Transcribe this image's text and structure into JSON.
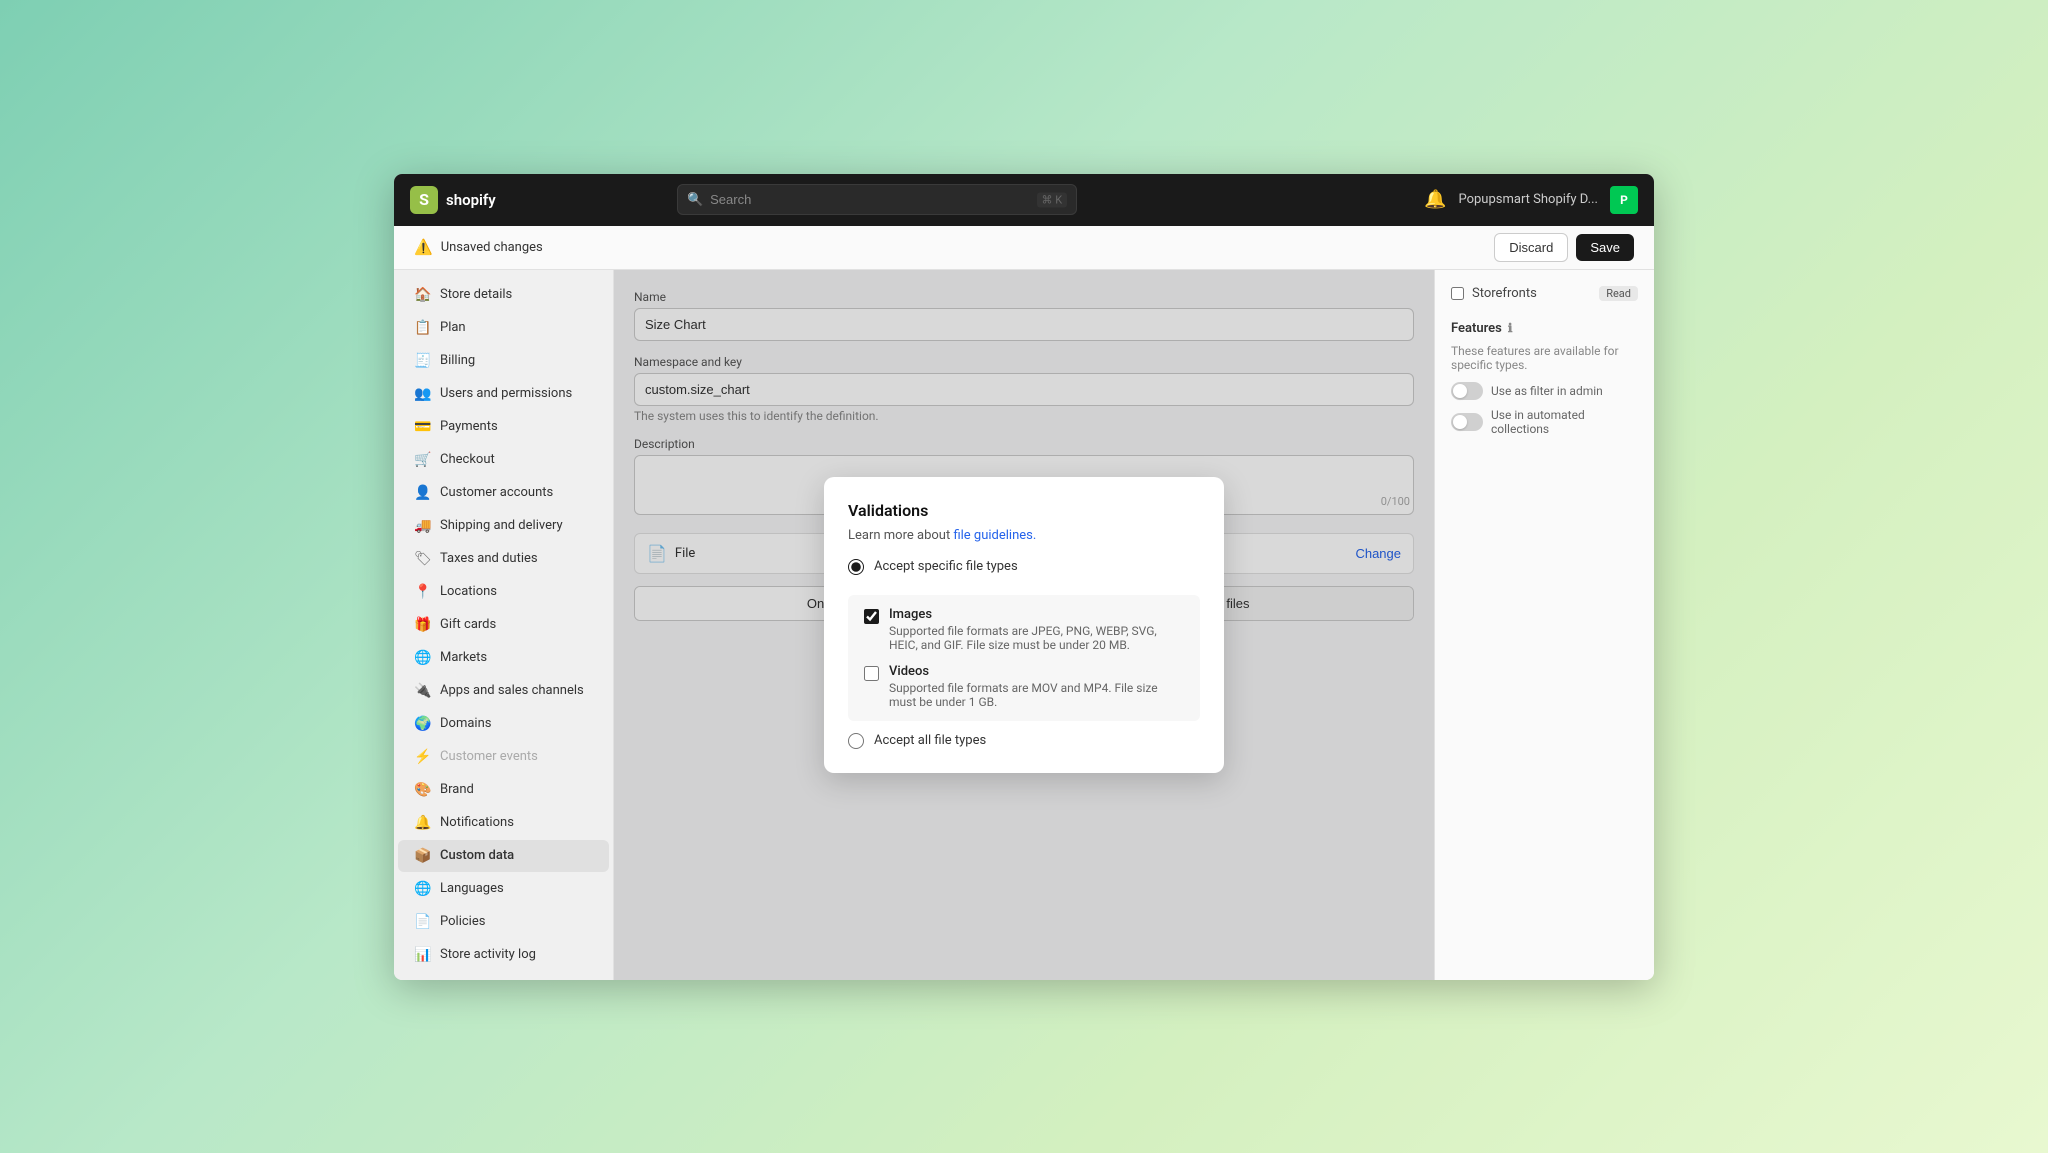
{
  "topbar": {
    "logo_text": "shopify",
    "search_placeholder": "Search",
    "search_shortcut": "⌘ K",
    "store_name": "Popupsmart Shopify D...",
    "store_avatar_initials": "P",
    "notification_icon": "🔔"
  },
  "unsaved_bar": {
    "text": "Unsaved changes",
    "discard_label": "Discard",
    "save_label": "Save"
  },
  "sidebar": {
    "items": [
      {
        "id": "store-details",
        "label": "Store details",
        "icon": "🏠"
      },
      {
        "id": "plan",
        "label": "Plan",
        "icon": "📋"
      },
      {
        "id": "billing",
        "label": "Billing",
        "icon": "🧾"
      },
      {
        "id": "users-permissions",
        "label": "Users and permissions",
        "icon": "👥"
      },
      {
        "id": "payments",
        "label": "Payments",
        "icon": "💳"
      },
      {
        "id": "checkout",
        "label": "Checkout",
        "icon": "🛒"
      },
      {
        "id": "customer-accounts",
        "label": "Customer accounts",
        "icon": "👤"
      },
      {
        "id": "shipping-delivery",
        "label": "Shipping and delivery",
        "icon": "🚚"
      },
      {
        "id": "taxes-duties",
        "label": "Taxes and duties",
        "icon": "🏷"
      },
      {
        "id": "locations",
        "label": "Locations",
        "icon": "📍"
      },
      {
        "id": "gift-cards",
        "label": "Gift cards",
        "icon": "🎁"
      },
      {
        "id": "markets",
        "label": "Markets",
        "icon": "🌐"
      },
      {
        "id": "apps-sales",
        "label": "Apps and sales channels",
        "icon": "🔌"
      },
      {
        "id": "domains",
        "label": "Domains",
        "icon": "🌍"
      },
      {
        "id": "customer-events",
        "label": "Customer events",
        "icon": "⚡"
      },
      {
        "id": "brand",
        "label": "Brand",
        "icon": "🎨"
      },
      {
        "id": "notifications",
        "label": "Notifications",
        "icon": "🔔"
      },
      {
        "id": "custom-data",
        "label": "Custom data",
        "icon": "📦"
      },
      {
        "id": "languages",
        "label": "Languages",
        "icon": "🌐"
      },
      {
        "id": "policies",
        "label": "Policies",
        "icon": "📄"
      },
      {
        "id": "store-activity-log",
        "label": "Store activity log",
        "icon": "📊"
      }
    ]
  },
  "center_form": {
    "name_label": "Name",
    "name_value": "Size Chart",
    "namespace_label": "Namespace and key",
    "namespace_value": "custom.size_chart",
    "namespace_hint": "The system uses this to identify the definition.",
    "description_label": "Description",
    "description_value": "",
    "char_count": "0/100",
    "file_label": "File",
    "change_label": "Change",
    "tab_one_file": "One file",
    "tab_list_files": "List of files"
  },
  "right_panel": {
    "access_section": {
      "storefronts_label": "Storefronts",
      "storefronts_badge": "Read"
    },
    "features_section": {
      "title": "Features",
      "description": "These features are available for specific types.",
      "items": [
        {
          "label": "Use as filter in admin"
        },
        {
          "label": "Use in automated collections"
        }
      ]
    }
  },
  "modal": {
    "title": "Validations",
    "subtitle": "Learn more about",
    "link_text": "file guidelines.",
    "option_specific_label": "Accept specific file types",
    "option_all_label": "Accept all file types",
    "images_label": "Images",
    "images_desc": "Supported file formats are JPEG, PNG, WEBP, SVG, HEIC, and GIF. File size must be under 20 MB.",
    "videos_label": "Videos",
    "videos_desc": "Supported file formats are MOV and MP4. File size must be under 1 GB."
  }
}
